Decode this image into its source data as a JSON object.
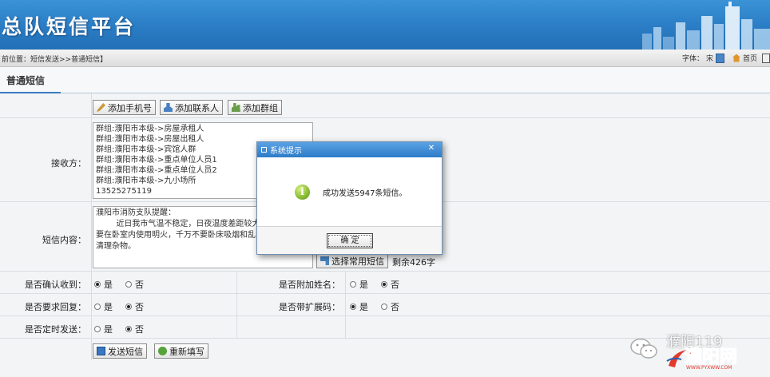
{
  "header": {
    "title": "总队短信平台"
  },
  "nav": {
    "location": "前位置：短信发送>>普通短信】",
    "font_label": "字体：",
    "font_value": "宋",
    "home_label": "首页"
  },
  "tab": {
    "label": "普通短信"
  },
  "recipient_buttons": {
    "add_phone": "添加手机号",
    "add_contact": "添加联系人",
    "add_group": "添加群组"
  },
  "recipients": {
    "label": "接收方：",
    "items": [
      "群组:濮阳市本级->房屋承租人",
      "群组:濮阳市本级->房屋出租人",
      "群组:濮阳市本级->宾馆人群",
      "群组:濮阳市本级->重点单位人员1",
      "群组:濮阳市本级->重点单位人员2",
      "群组:濮阳市本级->九小场所",
      "13525275119"
    ]
  },
  "content": {
    "label": "短信内容：",
    "text": "濮阳市消防支队提醒：\n        近日我市气温不稳定，日夜温度差距较大，\n要在卧室内使用明火，千万不要卧床吸烟和乱\n清理杂物。",
    "select_common": "选择常用短信",
    "remaining": "剩余426字"
  },
  "options": {
    "confirm_receipt": {
      "label": "是否确认收到：",
      "yes": "是",
      "no": "否",
      "selected": "yes"
    },
    "append_name": {
      "label": "是否附加姓名：",
      "yes": "是",
      "no": "否",
      "selected": "no"
    },
    "require_reply": {
      "label": "是否要求回复：",
      "yes": "是",
      "no": "否",
      "selected": "no"
    },
    "extension_code": {
      "label": "是否带扩展码：",
      "yes": "是",
      "no": "否",
      "selected": "yes"
    },
    "scheduled_send": {
      "label": "是否定时发送：",
      "yes": "是",
      "no": "否",
      "selected": "no"
    }
  },
  "actions": {
    "send": "发送短信",
    "reset": "重新填写"
  },
  "modal": {
    "title": "系统提示",
    "message": "成功发送5947条短信。",
    "ok": "确 定"
  },
  "watermark": {
    "text1": "濮阳119",
    "text2": "濮阳网",
    "url": "WWW.PYXWW.COM"
  },
  "colors": {
    "header": "#2a7cc4",
    "accent": "#3a7cc0",
    "watermark_red": "#e23b2e"
  }
}
